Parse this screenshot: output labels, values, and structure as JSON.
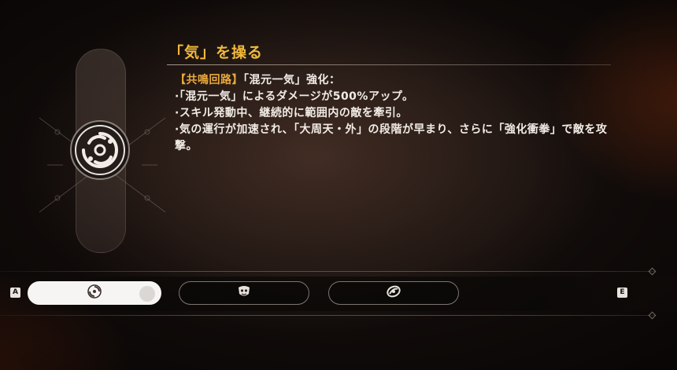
{
  "skill": {
    "title": "「気」を操る",
    "tag": "【共鳴回路】",
    "subtitle": "「混元一気」強化：",
    "lines": [
      "·「混元一気」によるダメージが500%アップ。",
      "·スキル発動中、継続的に範囲内の敵を牽引。",
      "·気の運行が加速され、「大周天・外」の段階が早まり、さらに「強化衝拳」で敵を攻撃。"
    ]
  },
  "emblem_icon": "spiral-circuit-emblem-icon",
  "tabs": [
    {
      "icon": "spiral-icon",
      "active": true
    },
    {
      "icon": "mask-icon",
      "active": false
    },
    {
      "icon": "swirl-icon",
      "active": false
    }
  ],
  "keys": {
    "prev": "A",
    "next": "E"
  },
  "colors": {
    "title": "#f0b93c",
    "tag": "#e8a83c",
    "text": "#f2ece6",
    "active_tab": "#f7f5f3"
  }
}
